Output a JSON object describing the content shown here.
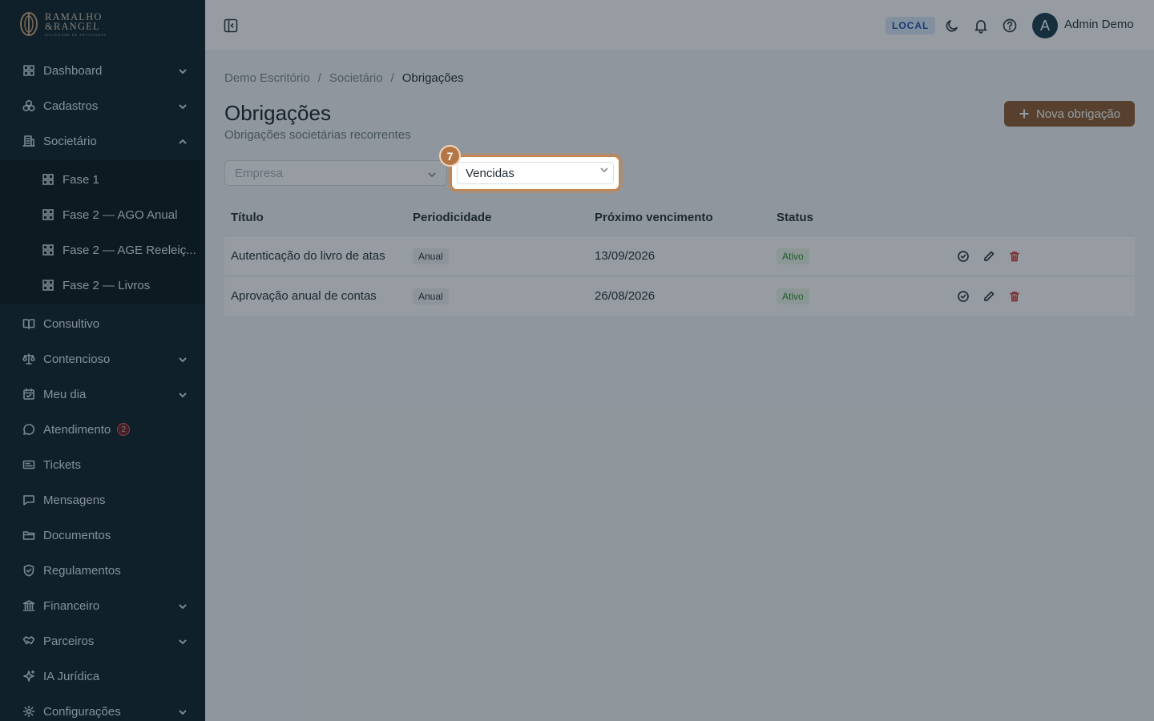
{
  "brand": {
    "line1": "RAMALHO",
    "line2": "&RANGEL",
    "line3": "SOCIEDADE DE ADVOGADOS",
    "color": "#0a1e27",
    "accent": "#8c5a2e"
  },
  "sidebar": {
    "items": [
      {
        "label": "Dashboard",
        "icon": "grid-icon",
        "expandable": true
      },
      {
        "label": "Cadastros",
        "icon": "cubes-icon",
        "expandable": true
      },
      {
        "label": "Societário",
        "icon": "building-icon",
        "expandable": true,
        "expanded": true
      },
      {
        "label": "Consultivo",
        "icon": "book-icon"
      },
      {
        "label": "Contencioso",
        "icon": "scale-icon",
        "expandable": true
      },
      {
        "label": "Meu dia",
        "icon": "calendar-icon",
        "expandable": true
      },
      {
        "label": "Atendimento",
        "icon": "chat-icon",
        "badge": "2"
      },
      {
        "label": "Tickets",
        "icon": "ticket-icon"
      },
      {
        "label": "Mensagens",
        "icon": "message-icon"
      },
      {
        "label": "Documentos",
        "icon": "folder-icon"
      },
      {
        "label": "Regulamentos",
        "icon": "shield-icon"
      },
      {
        "label": "Financeiro",
        "icon": "bank-icon",
        "expandable": true
      },
      {
        "label": "Parceiros",
        "icon": "handshake-icon",
        "expandable": true
      },
      {
        "label": "IA Jurídica",
        "icon": "sparkle-icon"
      },
      {
        "label": "Configurações",
        "icon": "gear-icon",
        "expandable": true
      }
    ],
    "subitems": [
      {
        "label": "Fase 1"
      },
      {
        "label": "Fase 2 — AGO Anual"
      },
      {
        "label": "Fase 2 — AGE Reeleiç..."
      },
      {
        "label": "Fase 2 — Livros"
      }
    ]
  },
  "header": {
    "env": "LOCAL",
    "avatar_initial": "A",
    "user_name": "Admin Demo"
  },
  "breadcrumb": {
    "b1": "Demo Escritório",
    "sep": "/",
    "b2": "Societário",
    "b3": "Obrigações"
  },
  "page": {
    "title": "Obrigações",
    "subtitle": "Obrigações societárias recorrentes",
    "new_button": "Nova obrigação"
  },
  "filters": {
    "company_placeholder": "Empresa",
    "status_value": "Vencidas"
  },
  "tour": {
    "step": "7"
  },
  "table": {
    "headers": [
      "Título",
      "Periodicidade",
      "Próximo vencimento",
      "Status"
    ],
    "rows": [
      {
        "title": "Autenticação do livro de atas",
        "period": "Anual",
        "due": "13/09/2026",
        "status": "Ativo"
      },
      {
        "title": "Aprovação anual de contas",
        "period": "Anual",
        "due": "26/08/2026",
        "status": "Ativo"
      }
    ]
  }
}
